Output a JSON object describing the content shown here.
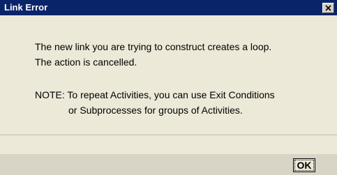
{
  "window": {
    "title": "Link Error",
    "close_icon": "close-icon"
  },
  "message": {
    "line1": "The new link you are trying to construct creates a loop.",
    "line2": "The action is cancelled.",
    "note_line1": "NOTE: To repeat Activities, you can use Exit Conditions",
    "note_line2": "or Subprocesses for groups of Activities."
  },
  "buttons": {
    "ok_label": "OK"
  },
  "colors": {
    "titlebar": "#0a246a",
    "body": "#ece9d8"
  }
}
